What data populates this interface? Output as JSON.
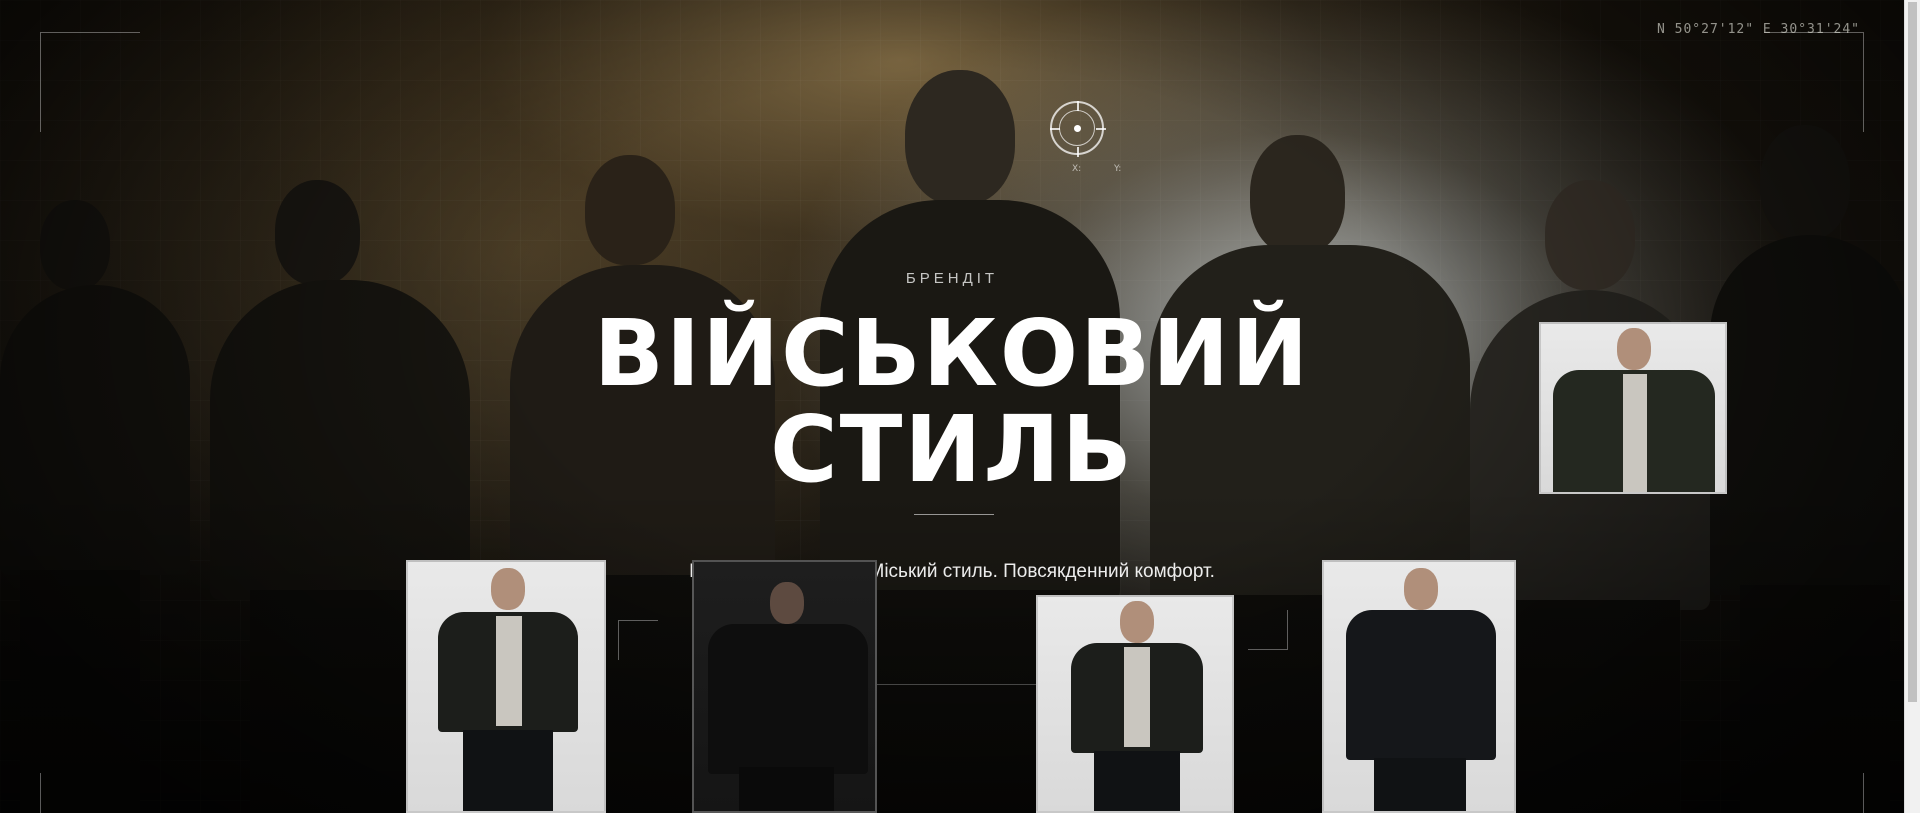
{
  "hero": {
    "eyebrow": "БРЕНДІТ",
    "title_line1": "ВІЙСЬКОВИЙ",
    "title_line2": "СТИЛЬ",
    "subtitle": "Військова естетика. Міський стиль. Повсякденний комфорт.",
    "coords": "N 50°27'12\" E 30°31'24\"",
    "target_x_label": "X:",
    "target_y_label": "Y:"
  },
  "thumbnails": [
    {
      "name": "model-thumb-1",
      "alt": "model-photo"
    },
    {
      "name": "model-thumb-2",
      "alt": "model-photo"
    },
    {
      "name": "model-thumb-3",
      "alt": "model-photo"
    },
    {
      "name": "model-thumb-4",
      "alt": "model-photo"
    },
    {
      "name": "model-thumb-5",
      "alt": "model-photo"
    }
  ],
  "icons": {
    "target": "crosshair-target-icon"
  },
  "colors": {
    "background": "#0a0906",
    "text": "#ffffff",
    "accent_fog": "#c8cbcb"
  }
}
